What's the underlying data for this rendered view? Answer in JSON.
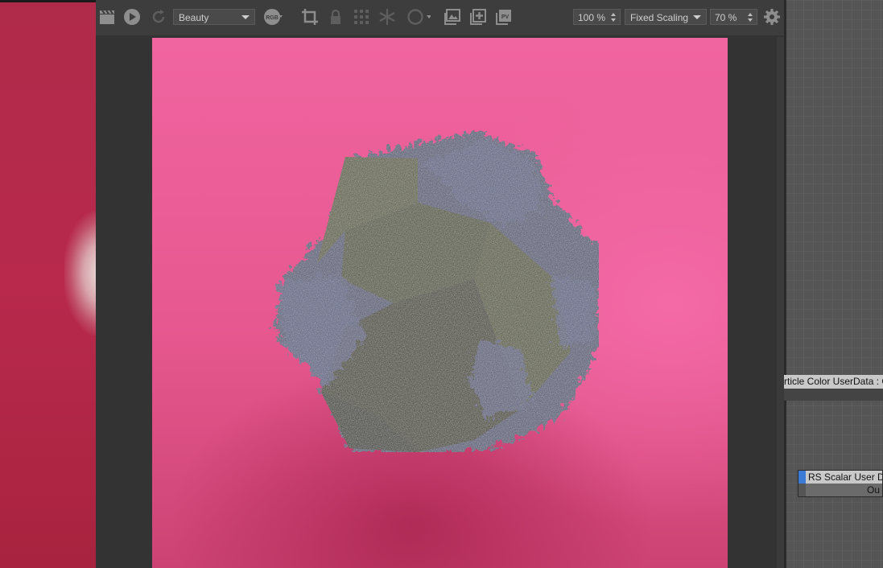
{
  "toolbar": {
    "aov_value": "Beauty",
    "zoom_value": "100 %",
    "scaling_value": "Fixed Scaling",
    "scale_percent": "70 %",
    "rgb_label": "RGB",
    "pv_label": "PV"
  },
  "nodes": {
    "particle_color_label": "rticle Color UserData : Co",
    "scalar_userdata_label": "RS Scalar User Dat",
    "scalar_userdata_port": "Ou"
  },
  "icons": [
    "clapperboard-icon",
    "play-icon",
    "refresh-icon",
    "rgb-icon",
    "crop-icon",
    "lock-icon",
    "grid-icon",
    "snowflake-icon",
    "circle-icon",
    "image-icon",
    "add-image-icon",
    "pv-icon",
    "gear-icon"
  ],
  "colors": {
    "render_bg": "#f064a0",
    "toolbar_bg": "#3d3d3d",
    "node_accent": "#3b7bd6"
  }
}
